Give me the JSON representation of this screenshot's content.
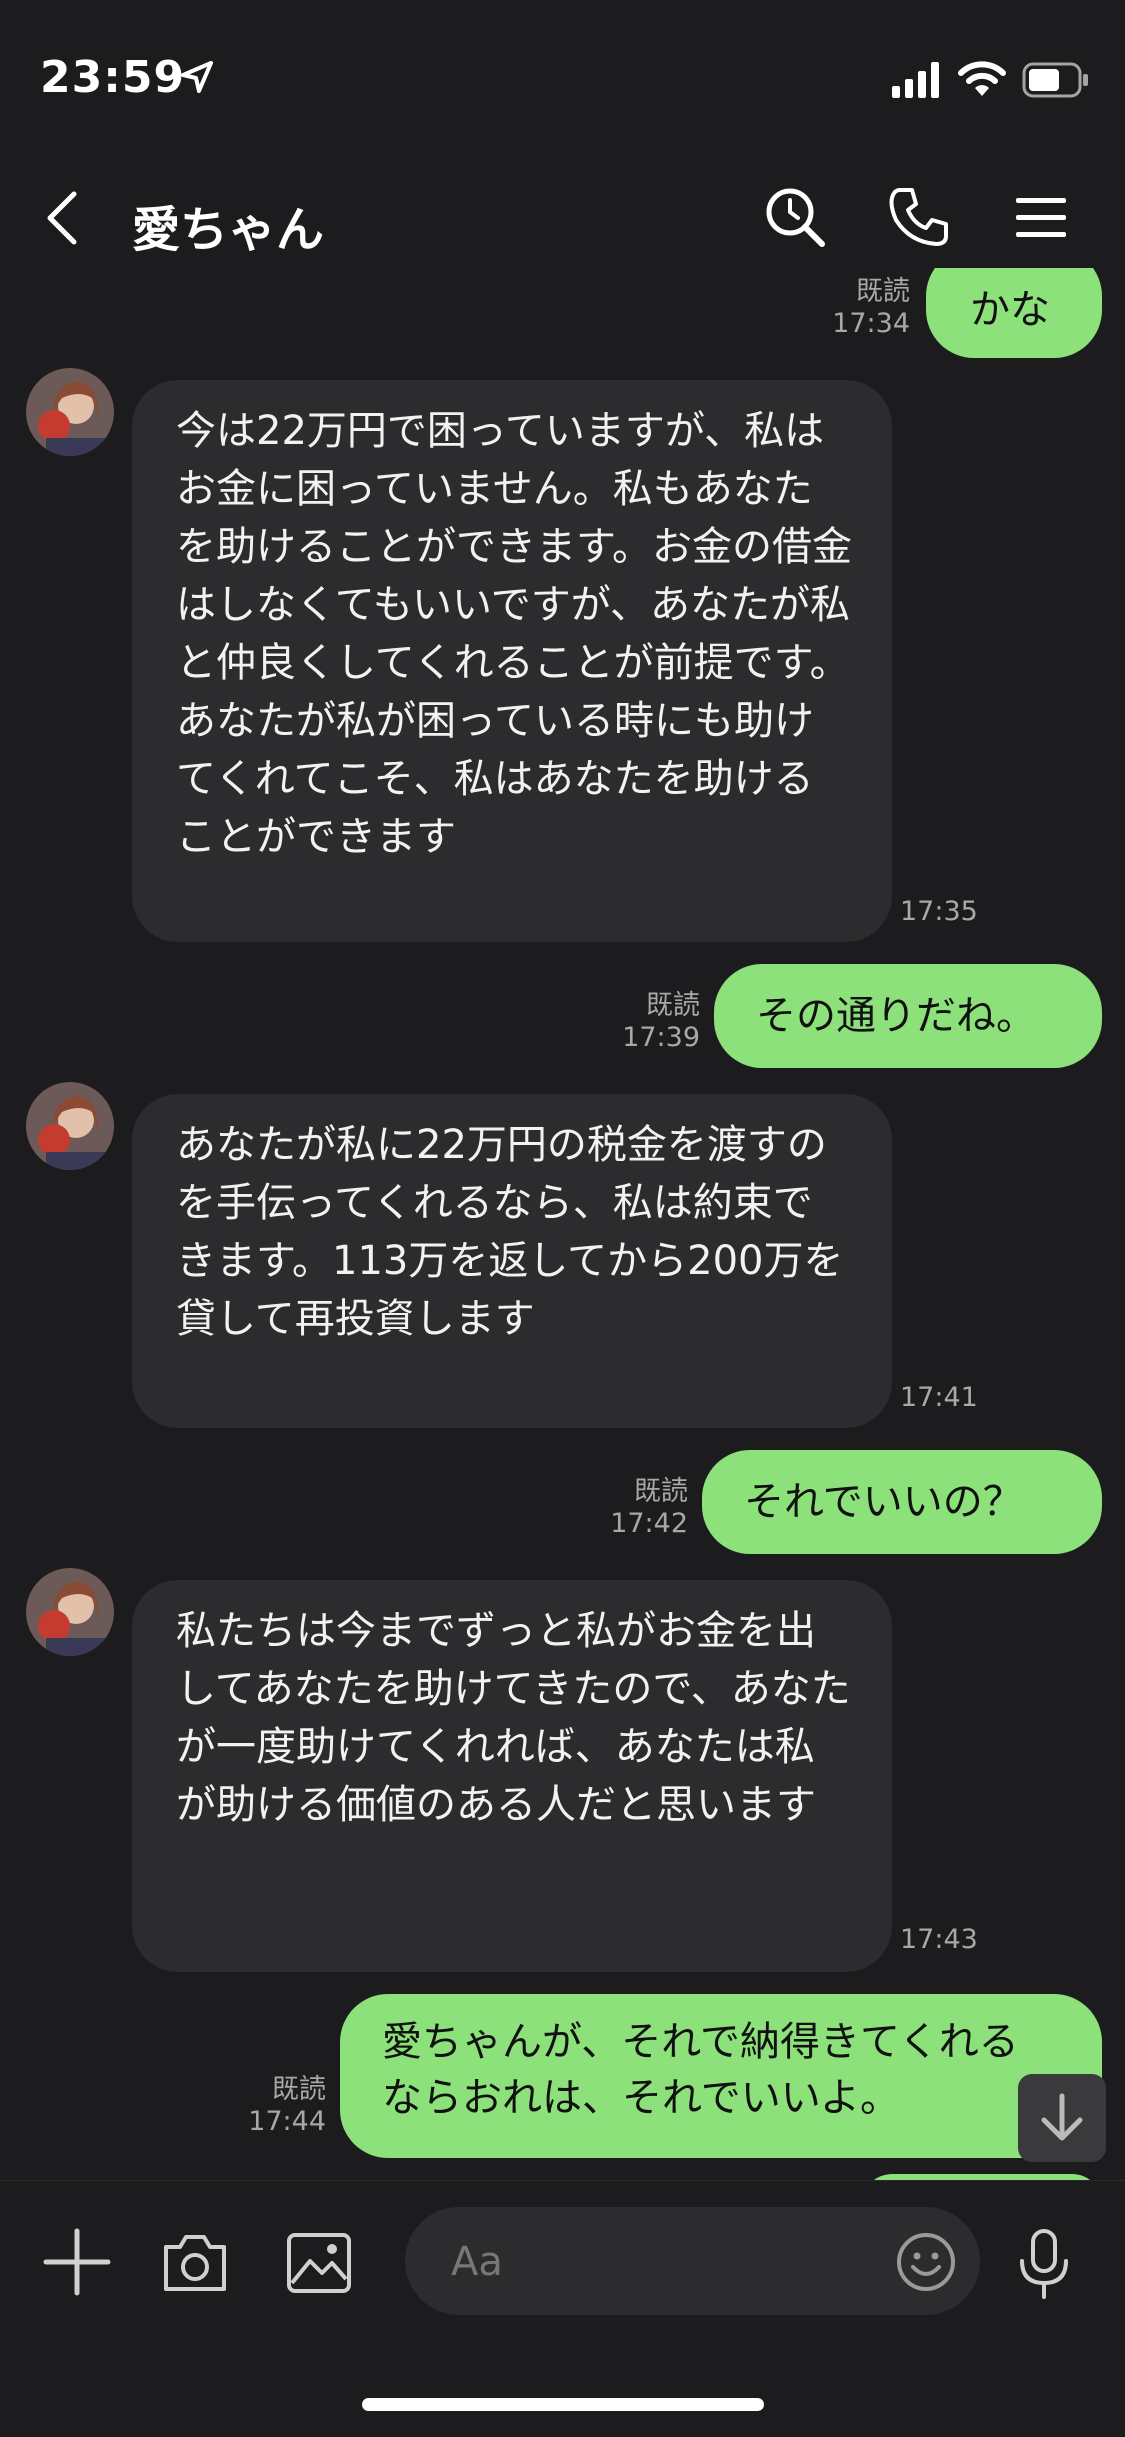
{
  "status_bar": {
    "time": "23:59"
  },
  "header": {
    "title": "愛ちゃん"
  },
  "messages": [
    {
      "side": "out",
      "text": "かな",
      "read": "既読",
      "time": "17:34"
    },
    {
      "side": "in",
      "text": "今は22万円で困っていますが、私はお金に困っていません。私もあなたを助けることができます。お金の借金はしなくてもいいですが、あなたが私と仲良くしてくれることが前提です。あなたが私が困っている時にも助けてくれてこそ、私はあなたを助けることができます",
      "time": "17:35"
    },
    {
      "side": "out",
      "text": "その通りだね。",
      "read": "既読",
      "time": "17:39"
    },
    {
      "side": "in",
      "text": "あなたが私に22万円の税金を渡すのを手伝ってくれるなら、私は約束できます。113万を返してから200万を貸して再投資します",
      "time": "17:41"
    },
    {
      "side": "out",
      "text": "それでいいの？",
      "read": "既読",
      "time": "17:42"
    },
    {
      "side": "in",
      "text": "私たちは今までずっと私がお金を出してあなたを助けてきたので、あなたが一度助けてくれれば、あなたは私が助ける価値のある人だと思います",
      "time": "17:43"
    },
    {
      "side": "out",
      "text": "愛ちゃんが、それで納得きてくれるならおれは、それでいいよ。",
      "read": "既読",
      "time": "17:44"
    }
  ],
  "input": {
    "placeholder": "Aa"
  },
  "colors": {
    "background": "#1c1c1e",
    "incoming_bubble": "#2c2c2e",
    "outgoing_bubble": "#8de17a",
    "meta_text": "#a8a8a8"
  }
}
